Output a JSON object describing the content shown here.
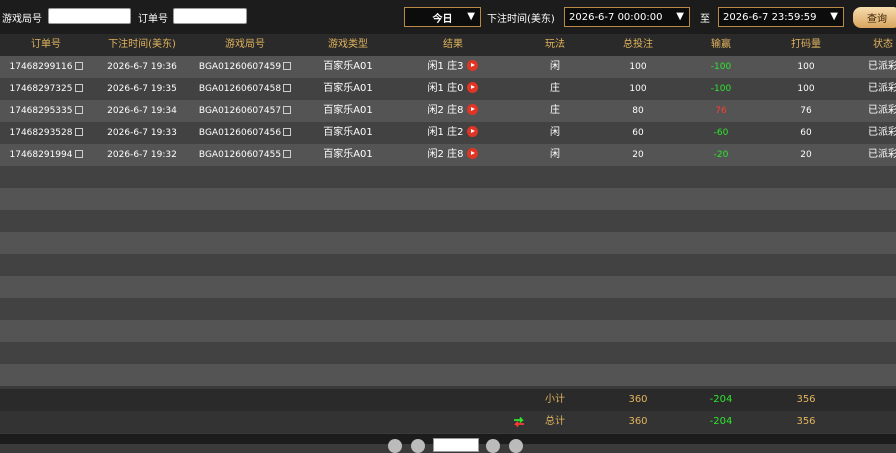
{
  "filter": {
    "game_round_label": "游戏局号",
    "order_no_label": "订单号",
    "period_select": "今日",
    "bet_time_label": "下注时间(美东)",
    "start_time": "2026-6-7 00:00:00",
    "to_label": "至",
    "end_time": "2026-6-7 23:59:59",
    "query_button": "查询"
  },
  "table": {
    "columns": [
      "订单号",
      "下注时间(美东)",
      "游戏局号",
      "游戏类型",
      "结果",
      "玩法",
      "总投注",
      "输赢",
      "打码量",
      "状态"
    ],
    "rows": [
      {
        "order": "17468299116",
        "time": "2026-6-7 19:36",
        "round": "BGA01260607459",
        "game": "百家乐A01",
        "result": "闲1 庄3",
        "play": "闲",
        "bet": "100",
        "winloss": "-100",
        "valid": "100",
        "status": "已派彩"
      },
      {
        "order": "17468297325",
        "time": "2026-6-7 19:35",
        "round": "BGA01260607458",
        "game": "百家乐A01",
        "result": "闲1 庄0",
        "play": "庄",
        "bet": "100",
        "winloss": "-100",
        "valid": "100",
        "status": "已派彩"
      },
      {
        "order": "17468295335",
        "time": "2026-6-7 19:34",
        "round": "BGA01260607457",
        "game": "百家乐A01",
        "result": "闲2 庄8",
        "play": "庄",
        "bet": "80",
        "winloss": "76",
        "valid": "76",
        "status": "已派彩"
      },
      {
        "order": "17468293528",
        "time": "2026-6-7 19:33",
        "round": "BGA01260607456",
        "game": "百家乐A01",
        "result": "闲1 庄2",
        "play": "闲",
        "bet": "60",
        "winloss": "-60",
        "valid": "60",
        "status": "已派彩"
      },
      {
        "order": "17468291994",
        "time": "2026-6-7 19:32",
        "round": "BGA01260607455",
        "game": "百家乐A01",
        "result": "闲2 庄8",
        "play": "闲",
        "bet": "20",
        "winloss": "-20",
        "valid": "20",
        "status": "已派彩"
      }
    ]
  },
  "summary": {
    "subtotal_label": "小计",
    "subtotal_bet": "360",
    "subtotal_winloss": "-204",
    "subtotal_valid": "356",
    "total_label": "总计",
    "total_bet": "360",
    "total_winloss": "-204",
    "total_valid": "356"
  },
  "colors": {
    "accent": "#e0b35d",
    "win": "#ff3b30",
    "loss": "#2ee62e"
  },
  "icons": {
    "copy": "copy-icon",
    "play": "play-replay-icon",
    "refresh": "refresh-icon"
  }
}
